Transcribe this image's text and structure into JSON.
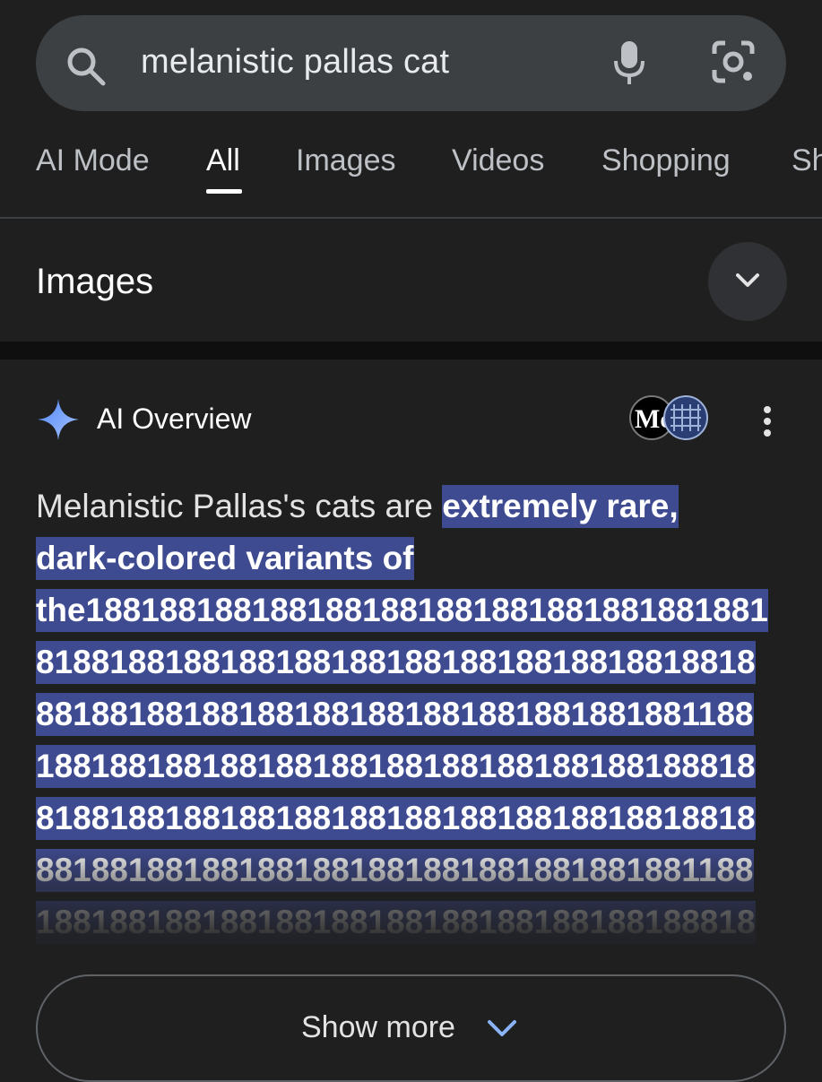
{
  "search": {
    "query": "melanistic pallas cat",
    "icons": [
      "search-icon",
      "mic-icon",
      "lens-icon"
    ]
  },
  "tabs": [
    {
      "label": "AI Mode",
      "active": false
    },
    {
      "label": "All",
      "active": true
    },
    {
      "label": "Images",
      "active": false
    },
    {
      "label": "Videos",
      "active": false
    },
    {
      "label": "Shopping",
      "active": false
    },
    {
      "label": "Sh",
      "active": false
    }
  ],
  "images_section": {
    "title": "Images",
    "icon": "chevron-down-icon"
  },
  "ai_overview": {
    "title": "AI Overview",
    "icon": "sparkle-icon",
    "source_avatar_text": "Mc",
    "lines": [
      {
        "plain": "Melanistic Pallas's cats are ",
        "highlight": "extremely rare,"
      },
      {
        "plain": "",
        "highlight": "dark-colored variants of"
      },
      {
        "plain": "",
        "highlight": "the1881881881881881881881881881881881881"
      },
      {
        "plain": "",
        "highlight": "818818818818818818818818818818818818818"
      },
      {
        "plain": "",
        "highlight": "881881881881881881881881881881881881188"
      },
      {
        "plain": "",
        "highlight": "188188188188188188188188188188188188818"
      },
      {
        "plain": "",
        "highlight": "818818818818818818818818818818818818818"
      },
      {
        "plain": "",
        "highlight": "881881881881881881881881881881881881188"
      },
      {
        "plain": "",
        "highlight": "188188188188188188188188188188188188818"
      }
    ],
    "show_more": "Show more"
  },
  "colors": {
    "background": "#1f1f1f",
    "search_bar": "#3c4043",
    "highlight": "#3f4b91",
    "gemini_blue": "#8ab4f8"
  }
}
